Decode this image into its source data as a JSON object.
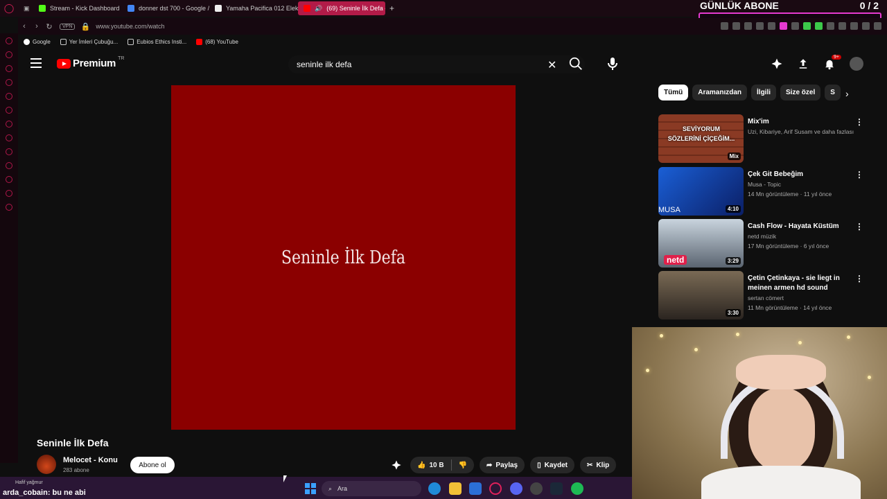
{
  "overlay": {
    "title": "GÜNLÜK ABONE",
    "count": "0 / 2"
  },
  "browser": {
    "tabs": [
      {
        "label": "Stream - Kick Dashboard",
        "color": "#53fc18"
      },
      {
        "label": "donner dst 700 - Google /",
        "color": "#4285f4"
      },
      {
        "label": "Yamaha Pacifica 012 Elekt",
        "color": "#ffffff"
      },
      {
        "label": "(69) Seninle İlk Defa -",
        "color": "#ff0000"
      }
    ],
    "vpn": "VPN",
    "url": "www.youtube.com/watch",
    "bookmarks": [
      "Google",
      "Yer İmleri Çubuğu...",
      "Eubios Ethics Insti...",
      "(68) YouTube"
    ]
  },
  "youtube": {
    "brand": "Premium",
    "country": "TR",
    "search_value": "seninle ilk defa",
    "notification_badge": "9+"
  },
  "video": {
    "overlay_text": "Seninle İlk Defa",
    "title": "Seninle İlk Defa",
    "channel": "Melocet - Konu",
    "subscribers": "283 abone",
    "subscribe_label": "Abone ol",
    "likes": "10 B",
    "share_label": "Paylaş",
    "save_label": "Kaydet",
    "clip_label": "Klip"
  },
  "chips": [
    "Tümü",
    "Aramanızdan",
    "İlgili",
    "Size özel",
    "S"
  ],
  "recommendations": [
    {
      "title": "Mix'im",
      "line1": "Uzi, Kibariye, Arif Susam ve daha fazlası",
      "line2": "",
      "duration": "Mix",
      "thumb_text": "SEVİYORUM SÖZLERİNİ ÇİÇEĞİM..."
    },
    {
      "title": "Çek Git Bebeğim",
      "line1": "Musa - Topic",
      "line2": "14 Mn görüntüleme · 11 yıl önce",
      "duration": "4:10",
      "thumb_text": "MUSA"
    },
    {
      "title": "Cash Flow - Hayata Küstüm",
      "line1": "netd müzik",
      "line2": "17 Mn görüntüleme · 6 yıl önce",
      "duration": "3:29",
      "thumb_text": "netd"
    },
    {
      "title": "Çetin Çetinkaya - sie liegt in meinen armen hd sound",
      "line1": "sertan cömert",
      "line2": "11 Mn görüntüleme · 14 yıl önce",
      "duration": "3:30",
      "thumb_text": ""
    }
  ],
  "chat": {
    "user": "arda_cobain",
    "message": ": bu ne abi"
  },
  "taskbar": {
    "weather": "Hafif yağmur",
    "search_placeholder": "Ara"
  }
}
